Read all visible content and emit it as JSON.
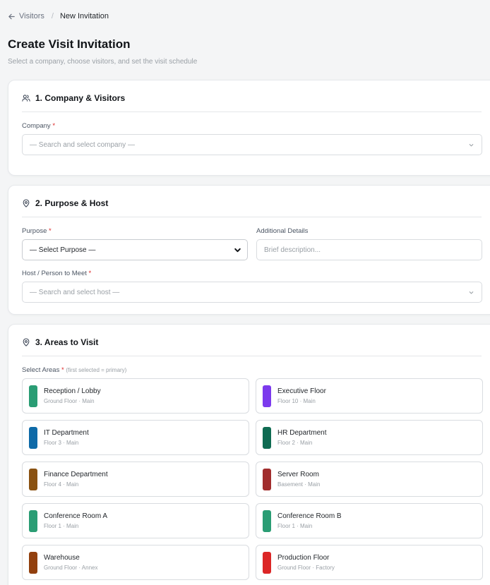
{
  "breadcrumb": {
    "back_label": "Visitors",
    "separator": "/",
    "current": "New Invitation"
  },
  "page": {
    "title": "Create Visit Invitation",
    "subtitle": "Select a company, choose visitors, and set the visit schedule"
  },
  "section1": {
    "title": "1. Company & Visitors",
    "company_label": "Company",
    "company_placeholder": "— Search and select company —"
  },
  "section2": {
    "title": "2. Purpose & Host",
    "purpose_label": "Purpose",
    "purpose_value": "— Select Purpose —",
    "details_label": "Additional Details",
    "details_placeholder": "Brief description...",
    "host_label": "Host / Person to Meet",
    "host_placeholder": "— Search and select host —"
  },
  "section3": {
    "title": "3. Areas to Visit",
    "areas_label": "Select Areas",
    "areas_hint": "(first selected = primary)",
    "areas": [
      {
        "name": "Reception / Lobby",
        "meta": "Ground Floor · Main",
        "color": "#2a9d74"
      },
      {
        "name": "Executive Floor",
        "meta": "Floor 10 · Main",
        "color": "#7c3aed"
      },
      {
        "name": "IT Department",
        "meta": "Floor 3 · Main",
        "color": "#0e6aa8"
      },
      {
        "name": "HR Department",
        "meta": "Floor 2 · Main",
        "color": "#0f6b52"
      },
      {
        "name": "Finance Department",
        "meta": "Floor 4 · Main",
        "color": "#8a5212"
      },
      {
        "name": "Server Room",
        "meta": "Basement · Main",
        "color": "#a12d2d"
      },
      {
        "name": "Conference Room A",
        "meta": "Floor 1 · Main",
        "color": "#2a9d74"
      },
      {
        "name": "Conference Room B",
        "meta": "Floor 1 · Main",
        "color": "#2a9d74"
      },
      {
        "name": "Warehouse",
        "meta": "Ground Floor · Annex",
        "color": "#92400e"
      },
      {
        "name": "Production Floor",
        "meta": "Ground Floor · Factory",
        "color": "#dc2626"
      }
    ]
  },
  "required_marker": "*"
}
